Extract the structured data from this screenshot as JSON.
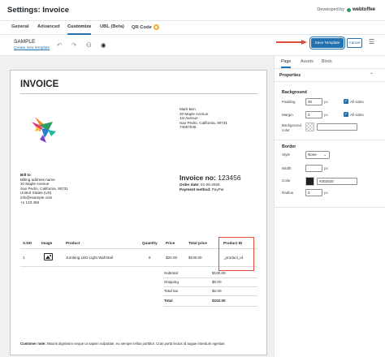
{
  "header": {
    "title": "Settings: Invoice",
    "developed_by": "Developed by",
    "brand": "webtoffee"
  },
  "tabs": [
    {
      "label": "General"
    },
    {
      "label": "Advanced"
    },
    {
      "label": "Customize"
    },
    {
      "label": "UBL (Beta)"
    },
    {
      "label": "QR Code"
    }
  ],
  "toolbar": {
    "template_name": "SAMPLE",
    "create_link": "Create new template",
    "save_label": "Save Template",
    "cancel_label": "Cancel"
  },
  "invoice": {
    "title": "INVOICE",
    "ship_to": [
      "Mark Ben",
      "20 Maple Avenue",
      "1st Avenue",
      "San Pedro, California, 90731",
      "74067545"
    ],
    "bill_to_label": "Bill to",
    "bill_to": [
      "Billing address name",
      "20 Maple Avenue",
      "San Pedro, California, 90731",
      "United States (US)",
      "info@example.com",
      "+1 123 456"
    ],
    "invoice_no_label": "Invoice no:",
    "invoice_no": "123456",
    "order_date_label": "Order date:",
    "order_date": "01-06-2025",
    "payment_label": "Payment method:",
    "payment": "PayPal",
    "columns": [
      "S.NO",
      "Image",
      "Product",
      "Quantity",
      "Price",
      "Total price",
      "Product ID"
    ],
    "row": {
      "sno": "1",
      "product": "Jumbing LED Light Wall Ball",
      "qty": "6",
      "price": "$20.00",
      "total": "$100.00",
      "product_id": "_product_id"
    },
    "summary": [
      {
        "label": "Subtotal",
        "value": "$100.00"
      },
      {
        "label": "Shipping",
        "value": "$0.00"
      },
      {
        "label": "Total tax",
        "value": "$2.00"
      },
      {
        "label": "Total",
        "value": "$102.00"
      }
    ],
    "note_label": "Customer note:",
    "note": "Mauris dignissim neque ut sapien vulputate, eu semper tellus porttitor. Cras porta lectus id augue interdum egestas"
  },
  "sidebar": {
    "tabs": [
      {
        "label": "Page"
      },
      {
        "label": "Assets"
      },
      {
        "label": "Block"
      }
    ],
    "properties": "Properties",
    "background": {
      "title": "Background",
      "padding_label": "Padding",
      "padding_value": "30",
      "margin_label": "Margin",
      "margin_value": "0",
      "unit": "px",
      "all_sides": "All sides",
      "bg_color_label": "Background color"
    },
    "border": {
      "title": "Border",
      "style_label": "Style",
      "style_value": "None",
      "width_label": "Width",
      "width_value": "",
      "color_label": "Color",
      "color_value": "#202020",
      "radius_label": "Radius",
      "radius_value": "0",
      "unit": "px"
    }
  },
  "colors": {
    "accent": "#2271b1",
    "highlight": "#e04b3a",
    "border_color_swatch": "#202020"
  }
}
